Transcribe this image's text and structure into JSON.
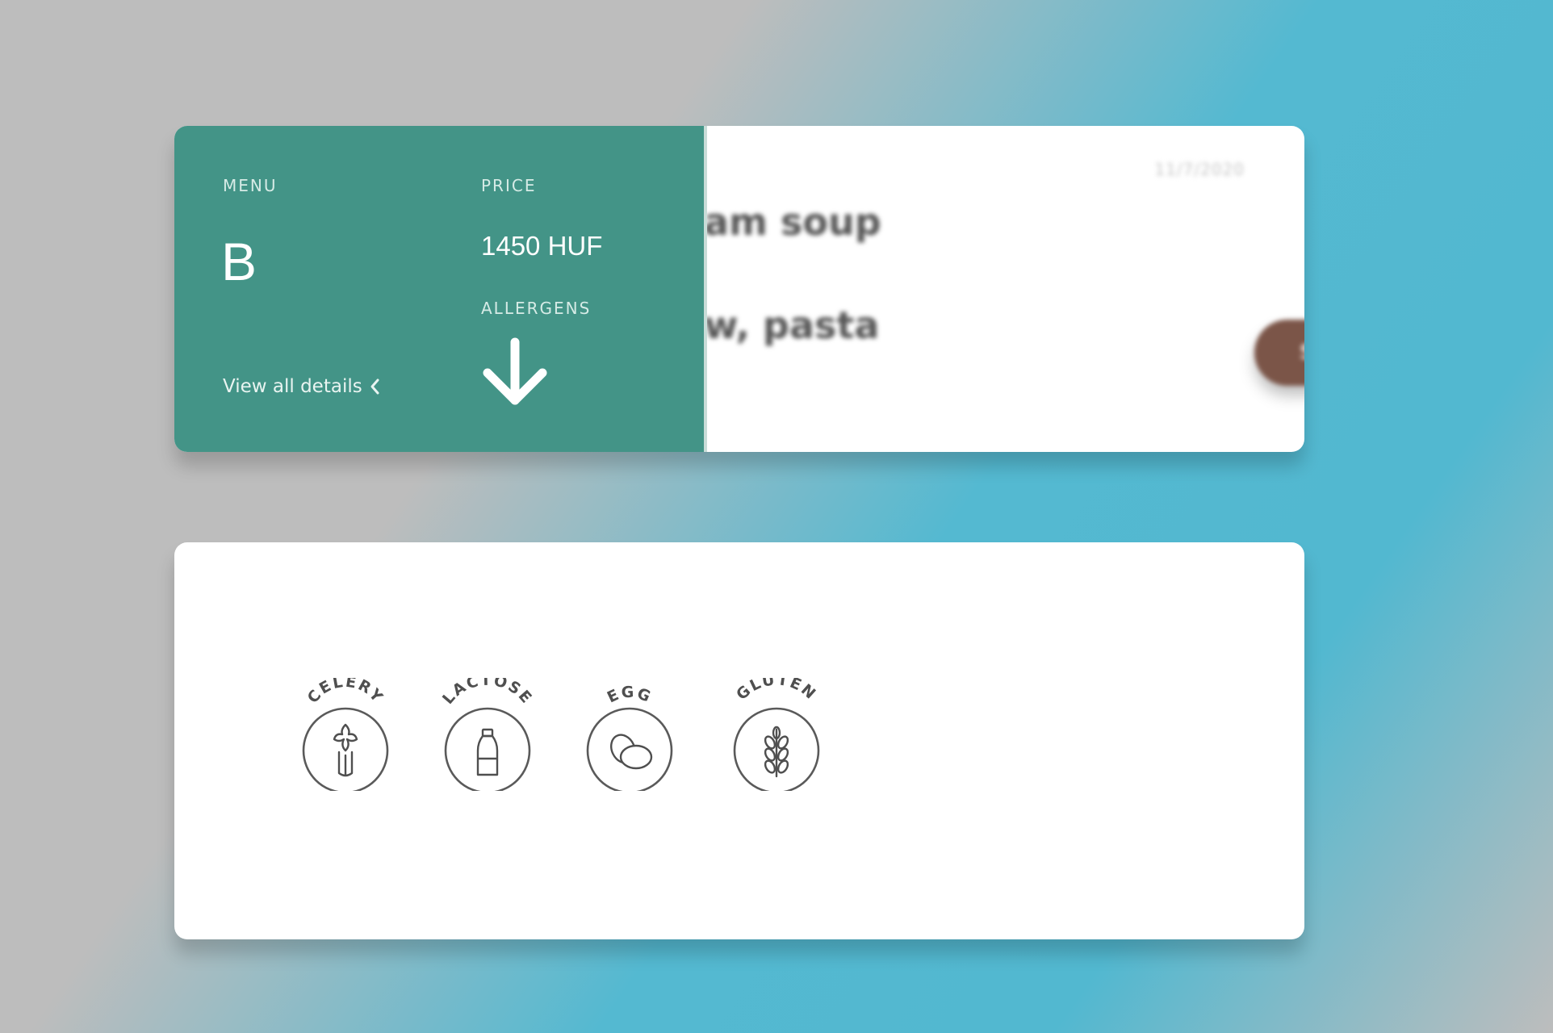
{
  "menu_card": {
    "menu_label": "MENU",
    "menu_letter": "B",
    "price_label": "PRICE",
    "price_value": "1450 HUF",
    "allergens_label": "ALLERGENS",
    "view_details_label": "View all details",
    "date": "11/7/2020",
    "soup_text": "am soup",
    "pasta_text": "w, pasta",
    "show_button_label": "Show A"
  },
  "allergens": [
    {
      "label": "CELERY",
      "icon": "celery-icon"
    },
    {
      "label": "LACTOSE",
      "icon": "milk-bottle-icon"
    },
    {
      "label": "EGG",
      "icon": "egg-icon"
    },
    {
      "label": "GLUTEN",
      "icon": "wheat-icon"
    }
  ],
  "colors": {
    "teal_panel": "#439487",
    "show_button": "#7b5548",
    "background_gray": "#bdbdbd",
    "background_blue": "#54b9d1"
  }
}
